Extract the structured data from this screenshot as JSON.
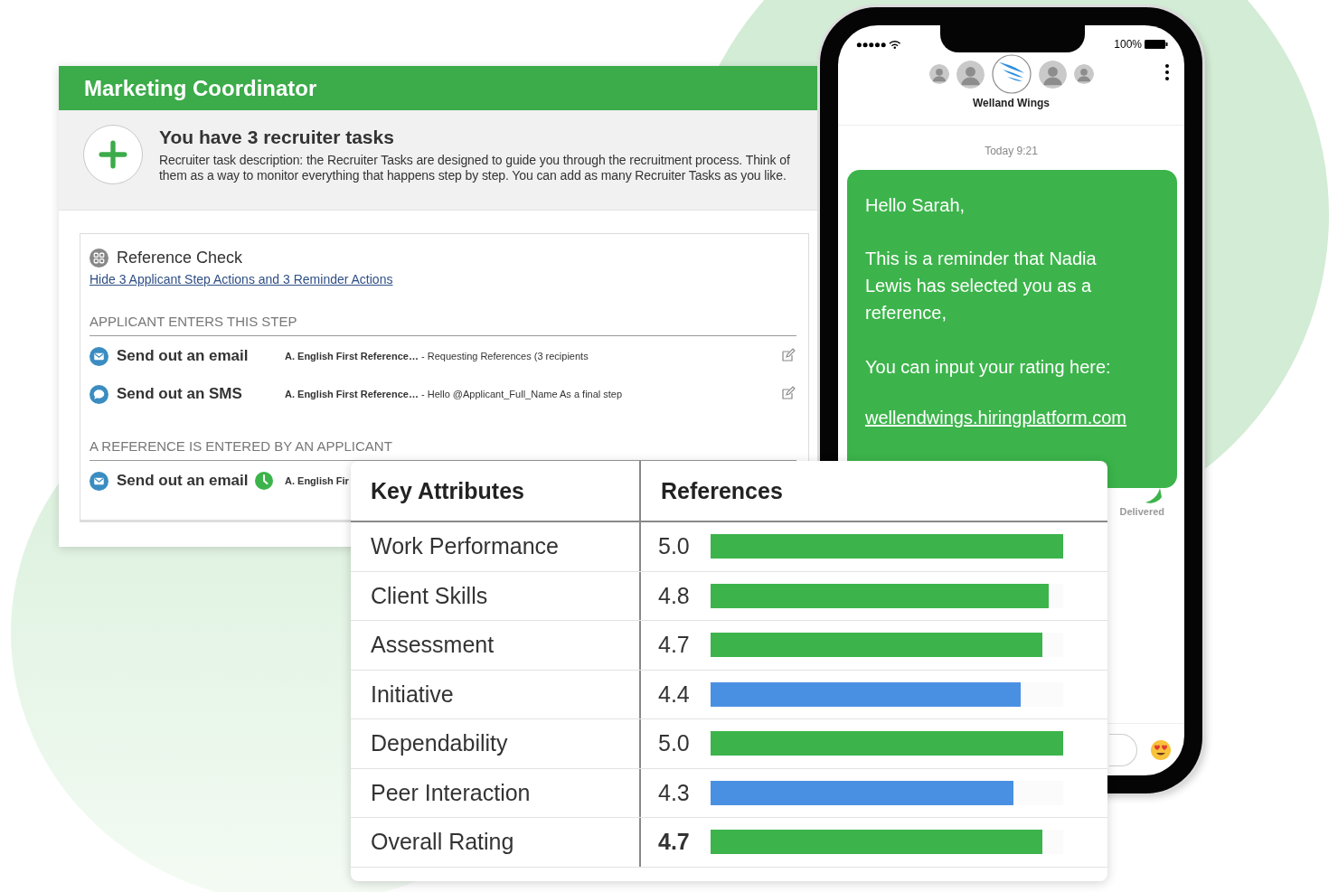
{
  "task_card": {
    "title": "Marketing Coordinator",
    "summary": {
      "heading": "You have 3 recruiter tasks",
      "description": "Recruiter task description: the Recruiter Tasks are designed to guide you through the recruitment process. Think of them as a way to monitor everything that happens step by step. You can add as many Recruiter Tasks as you like."
    },
    "step": {
      "title": "Reference Check",
      "toggle_link": "Hide 3 Applicant Step Actions and 3 Reminder Actions",
      "sections": [
        {
          "heading": "APPLICANT ENTERS THIS STEP",
          "actions": [
            {
              "kind": "email",
              "title": "Send out an email",
              "scheduled": false,
              "template": "A. English First Reference…",
              "detail": "- Requesting References (3 recipients",
              "editable": true
            },
            {
              "kind": "sms",
              "title": "Send out an SMS",
              "scheduled": false,
              "template": "A. English First Reference…",
              "detail": "- Hello @Applicant_Full_Name As a final step",
              "editable": true
            }
          ]
        },
        {
          "heading": "A REFERENCE IS ENTERED BY AN APPLICANT",
          "actions": [
            {
              "kind": "email",
              "title": "Send out an email",
              "scheduled": true,
              "template": "A. English Fir",
              "editable": false
            }
          ]
        }
      ]
    }
  },
  "phone": {
    "status": {
      "battery": "100%"
    },
    "contact": {
      "name": "Welland Wings"
    },
    "timestamp": "Today 9:21",
    "message": {
      "paragraphs": [
        "Hello Sarah,",
        "This is a reminder that Nadia Lewis has selected you as a reference,",
        "You can input your rating here:"
      ],
      "link": "wellendwings.hiringplatform.com",
      "status": "Delivered"
    }
  },
  "ratings": {
    "columns": [
      "Key Attributes",
      "References"
    ],
    "rows": [
      {
        "attribute": "Work Performance",
        "score": "5.0",
        "level": 1.0,
        "color": "#3cb44b",
        "emphasis": false
      },
      {
        "attribute": "Client Skills",
        "score": "4.8",
        "level": 0.96,
        "color": "#3cb44b",
        "emphasis": false
      },
      {
        "attribute": "Assessment",
        "score": "4.7",
        "level": 0.94,
        "color": "#3cb44b",
        "emphasis": false
      },
      {
        "attribute": "Initiative",
        "score": "4.4",
        "level": 0.88,
        "color": "#4a90e2",
        "emphasis": false
      },
      {
        "attribute": "Dependability",
        "score": "5.0",
        "level": 1.0,
        "color": "#3cb44b",
        "emphasis": false
      },
      {
        "attribute": "Peer Interaction",
        "score": "4.3",
        "level": 0.86,
        "color": "#4a90e2",
        "emphasis": false
      },
      {
        "attribute": "Overall Rating",
        "score": "4.7",
        "level": 0.94,
        "color": "#3cb44b",
        "emphasis": true
      }
    ]
  }
}
